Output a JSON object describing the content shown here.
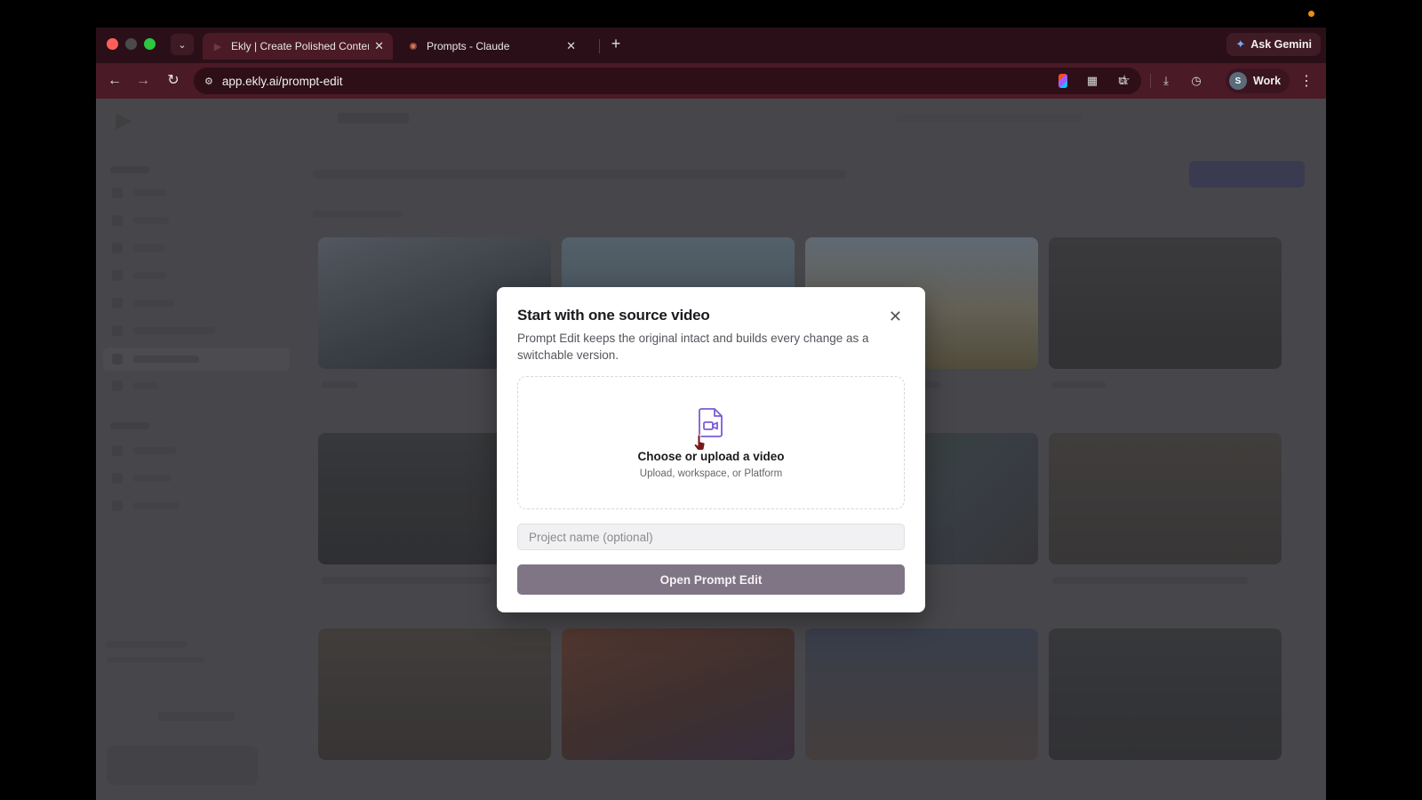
{
  "browser": {
    "tabs": [
      {
        "title": "Ekly | Create Polished Content",
        "active": true
      },
      {
        "title": "Prompts - Claude",
        "active": false
      }
    ],
    "url": "app.ekly.ai/prompt-edit",
    "gemini_label": "Ask Gemini",
    "profile": {
      "initial": "S",
      "name": "Work"
    }
  },
  "modal": {
    "title": "Start with one source video",
    "description": "Prompt Edit keeps the original intact and builds every change as a switchable version.",
    "dropzone": {
      "title": "Choose or upload a video",
      "subtitle": "Upload, workspace, or Platform",
      "icon": "video-file-icon"
    },
    "project_input": {
      "value": "",
      "placeholder": "Project name (optional)"
    },
    "primary_button": "Open Prompt Edit",
    "close_icon": "close-icon"
  },
  "colors": {
    "tab_bar": "#2b0f18",
    "toolbar": "#4a1a26",
    "accent": "#7c5cd6",
    "button": "#7f7584"
  }
}
